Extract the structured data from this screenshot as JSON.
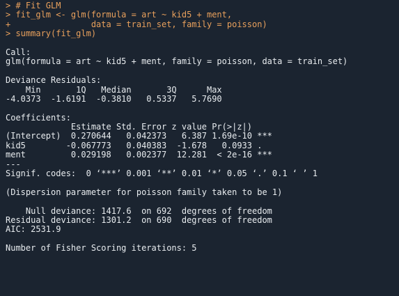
{
  "input": [
    "> # Fit GLM",
    "> fit_glm <- glm(formula = art ~ kid5 + ment,",
    "+                data = train_set, family = poisson)",
    "> summary(fit_glm)"
  ],
  "output": {
    "call": [
      "Call:",
      "glm(formula = art ~ kid5 + ment, family = poisson, data = train_set)"
    ],
    "deviance_residuals": [
      "Deviance Residuals:",
      "    Min       1Q   Median       3Q      Max  ",
      "-4.0373  -1.6191  -0.3810   0.5337   5.7690  "
    ],
    "coefficients": [
      "Coefficients:",
      "             Estimate Std. Error z value Pr(>|z|)    ",
      "(Intercept)  0.270644   0.042373   6.387 1.69e-10 ***",
      "kid5        -0.067773   0.040383  -1.678   0.0933 .  ",
      "ment         0.029198   0.002377  12.281  < 2e-16 ***",
      "---",
      "Signif. codes:  0 ‘***’ 0.001 ‘**’ 0.01 ‘*’ 0.05 ‘.’ 0.1 ‘ ’ 1"
    ],
    "dispersion": "(Dispersion parameter for poisson family taken to be 1)",
    "deviance": [
      "    Null deviance: 1417.6  on 692  degrees of freedom",
      "Residual deviance: 1301.2  on 690  degrees of freedom",
      "AIC: 2531.9"
    ],
    "fisher": "Number of Fisher Scoring iterations: 5"
  },
  "colors": {
    "background": "#1b2430",
    "input_text": "#e8a05c",
    "output_text": "#e8ecef"
  }
}
